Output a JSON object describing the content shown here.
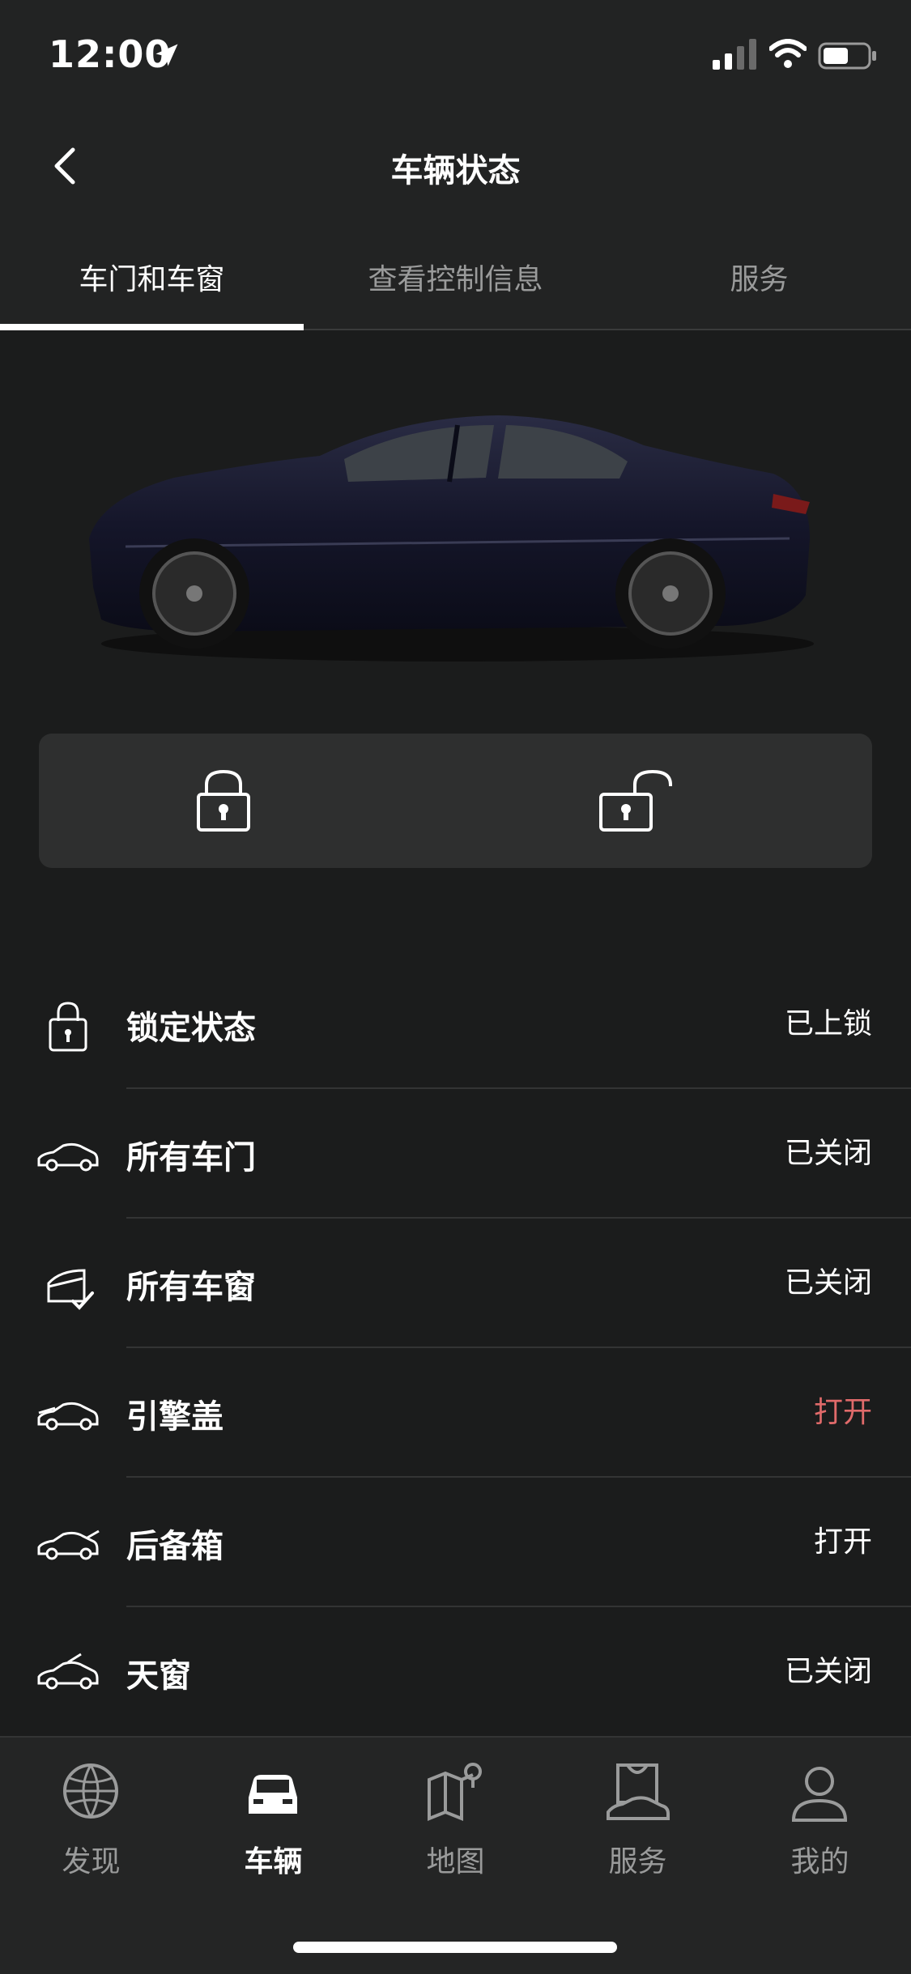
{
  "status_bar": {
    "time": "12:00"
  },
  "header": {
    "title": "车辆状态"
  },
  "tabs": [
    {
      "label": "车门和车窗",
      "active": true
    },
    {
      "label": "查看控制信息",
      "active": false
    },
    {
      "label": "服务",
      "active": false
    }
  ],
  "lock_panel": {
    "lock_icon": "lock-icon",
    "unlock_icon": "unlock-icon"
  },
  "status_list": [
    {
      "icon": "lock-icon",
      "label": "锁定状态",
      "value": "已上锁",
      "value_color": "#ffffff"
    },
    {
      "icon": "car-side-icon",
      "label": "所有车门",
      "value": "已关闭",
      "value_color": "#ffffff"
    },
    {
      "icon": "window-check-icon",
      "label": "所有车窗",
      "value": "已关闭",
      "value_color": "#ffffff"
    },
    {
      "icon": "car-hood-icon",
      "label": "引擎盖",
      "value": "打开",
      "value_color": "#e06a6a"
    },
    {
      "icon": "car-trunk-icon",
      "label": "后备箱",
      "value": "打开",
      "value_color": "#ffffff"
    },
    {
      "icon": "car-sunroof-icon",
      "label": "天窗",
      "value": "已关闭",
      "value_color": "#ffffff"
    }
  ],
  "bottom_nav": [
    {
      "icon": "globe-icon",
      "label": "发现",
      "active": false
    },
    {
      "icon": "car-front-icon",
      "label": "车辆",
      "active": true
    },
    {
      "icon": "map-pin-icon",
      "label": "地图",
      "active": false
    },
    {
      "icon": "service-bag-icon",
      "label": "服务",
      "active": false
    },
    {
      "icon": "person-icon",
      "label": "我的",
      "active": false
    }
  ],
  "colors": {
    "background": "#1b1c1c",
    "panel": "#2e2f2f",
    "alert": "#e06a6a",
    "inactive_text": "#9a9b9b"
  }
}
